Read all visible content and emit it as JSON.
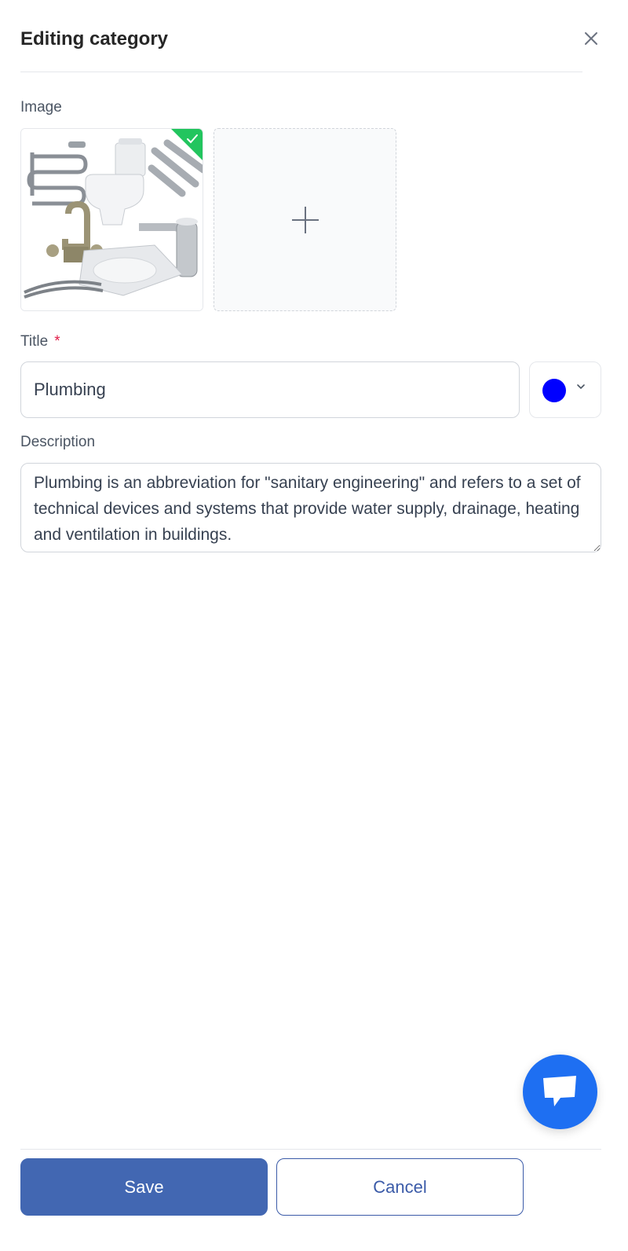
{
  "header": {
    "title": "Editing category",
    "close_icon": "close-icon"
  },
  "image": {
    "label": "Image",
    "selected_thumbnail": "plumbing-fixtures-photo",
    "selected_icon": "check-icon",
    "upload_icon": "plus-icon"
  },
  "title": {
    "label": "Title",
    "required_marker": "*",
    "value": "Plumbing"
  },
  "color": {
    "value": "#0000ff",
    "icon": "chevron-down-icon"
  },
  "description": {
    "label": "Description",
    "value": "Plumbing is an abbreviation for \"sanitary engineering\" and refers to a set of technical devices and systems that provide water supply, drainage, heating and ventilation in buildings."
  },
  "chat": {
    "icon": "chat-bubble-icon",
    "color": "#1e6ff2"
  },
  "footer": {
    "save_label": "Save",
    "cancel_label": "Cancel"
  },
  "colors": {
    "primary": "#4267b2",
    "success": "#22c55e",
    "required": "#e11d48"
  }
}
